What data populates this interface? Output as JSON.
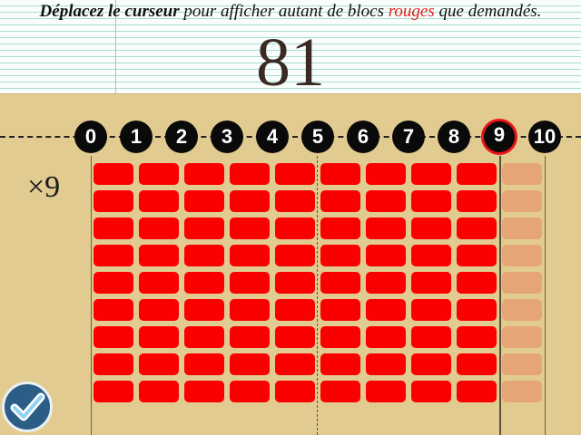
{
  "instruction": {
    "part1": "Déplacez le curseur",
    "part2": " pour afficher autant de blocs ",
    "part3": "rouges",
    "part4": " que demandés."
  },
  "result": "81",
  "multiplier_label": "×9",
  "scale": {
    "numbers": [
      "0",
      "1",
      "2",
      "3",
      "4",
      "5",
      "6",
      "7",
      "8",
      "9",
      "10"
    ],
    "selected_value": 9
  },
  "grid": {
    "rows": 9,
    "columns": 10,
    "red_columns": 9
  },
  "colors": {
    "red_block": "#fb0000",
    "ghost_block": "#e6a574",
    "selected_ring": "#e8141a",
    "background": "#e2cb90"
  },
  "icons": {
    "validate": "check-icon"
  }
}
